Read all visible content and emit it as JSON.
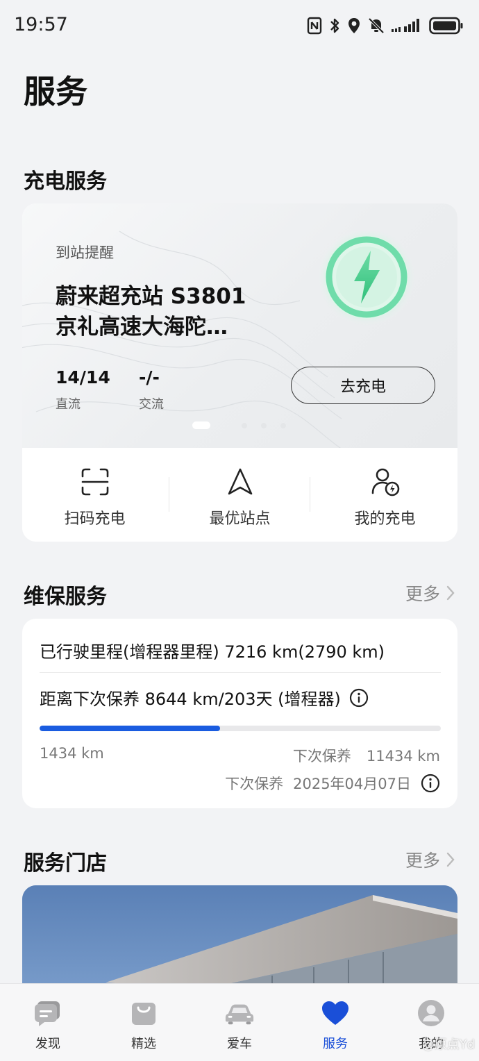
{
  "status_bar": {
    "time": "19:57",
    "icons": [
      "nfc-icon",
      "bluetooth-icon",
      "location-icon",
      "mute-icon",
      "signal-icon",
      "battery-icon"
    ]
  },
  "page": {
    "title": "服务"
  },
  "charging": {
    "section_title": "充电服务",
    "card": {
      "label": "到站提醒",
      "station_line1": "蔚来超充站 S3801",
      "station_line2": "京礼高速大海陀…",
      "dc_count": "14/14",
      "dc_label": "直流",
      "ac_count": "-/-",
      "ac_label": "交流",
      "button_label": "去充电",
      "bolt_icon": "lightning-bolt-icon",
      "accent_color": "#3ec98a"
    },
    "quick_actions": [
      {
        "label": "扫码充电",
        "icon": "scan-icon"
      },
      {
        "label": "最优站点",
        "icon": "navigation-arrow-icon"
      },
      {
        "label": "我的充电",
        "icon": "user-charging-icon"
      }
    ]
  },
  "maintenance": {
    "section_title": "维保服务",
    "more_label": "更多",
    "mileage_text": "已行驶里程(增程器里程) 7216 km(2790 km)",
    "next_service_text": "距离下次保养 8644 km/203天 (增程器)",
    "progress_fraction": 0.45,
    "progress_color": "#1a5ce0",
    "left_km": "1434 km",
    "next_label": "下次保养",
    "next_km": "11434 km",
    "next_date_label": "下次保养",
    "next_date": "2025年04月07日"
  },
  "stores": {
    "section_title": "服务门店",
    "more_label": "更多"
  },
  "tab_bar": {
    "tabs": [
      {
        "label": "发现",
        "icon": "chat-bubble-icon",
        "active": false
      },
      {
        "label": "精选",
        "icon": "shopping-bag-icon",
        "active": false
      },
      {
        "label": "爱车",
        "icon": "car-icon",
        "active": false
      },
      {
        "label": "服务",
        "icon": "heart-icon",
        "active": true
      },
      {
        "label": "我的",
        "icon": "profile-icon",
        "active": false
      }
    ],
    "active_color": "#1a4fd8"
  },
  "watermark": "@原点Yd"
}
